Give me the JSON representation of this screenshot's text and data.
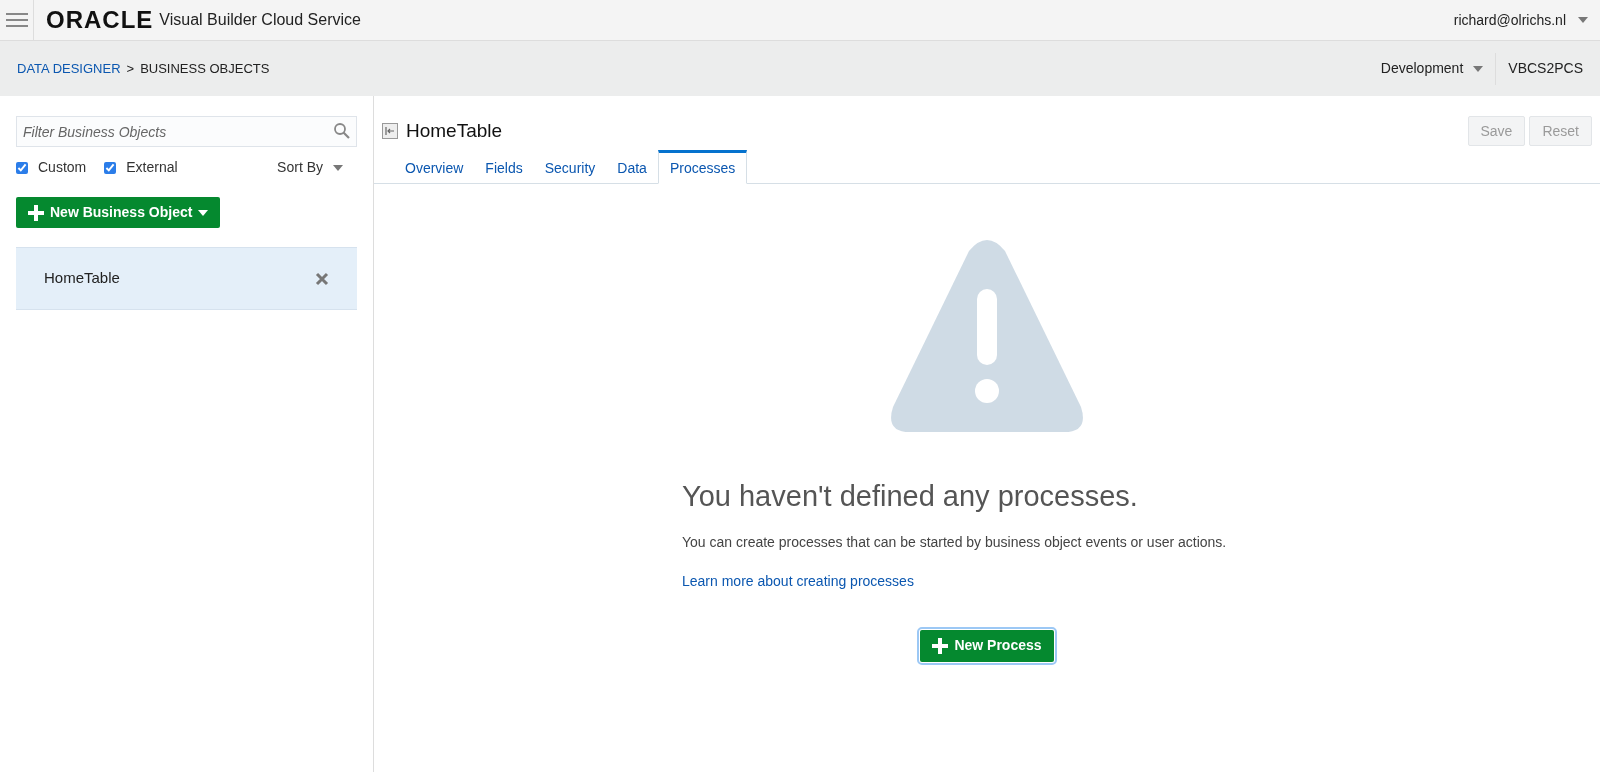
{
  "header": {
    "logo": "ORACLE",
    "product": "Visual Builder Cloud Service",
    "user": "richard@olrichs.nl"
  },
  "breadcrumb": {
    "link": "DATA DESIGNER",
    "separator": ">",
    "current": "BUSINESS OBJECTS"
  },
  "environment": {
    "value": "Development",
    "app": "VBCS2PCS"
  },
  "sidebar": {
    "search": {
      "placeholder": "Filter Business Objects"
    },
    "filters": [
      {
        "label": "Custom",
        "checked": true
      },
      {
        "label": "External",
        "checked": true
      }
    ],
    "sort": "Sort By",
    "new_button": "New Business Object",
    "items": [
      {
        "label": "HomeTable",
        "selected": true
      }
    ]
  },
  "detail": {
    "title": "HomeTable",
    "buttons": [
      {
        "label": "Save",
        "disabled": true
      },
      {
        "label": "Reset",
        "disabled": true
      }
    ],
    "tabs": [
      {
        "label": "Overview",
        "selected": false
      },
      {
        "label": "Fields",
        "selected": false
      },
      {
        "label": "Security",
        "selected": false
      },
      {
        "label": "Data",
        "selected": false
      },
      {
        "label": "Processes",
        "selected": true
      }
    ],
    "empty_state": {
      "heading": "You haven't defined any processes.",
      "text": "You can create processes that can be started by business object events or user actions.",
      "link": "Learn more about creating processes",
      "button": "New Process"
    }
  }
}
